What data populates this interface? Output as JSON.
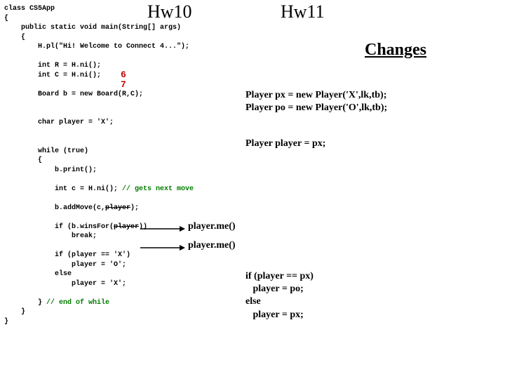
{
  "titles": {
    "left": "Hw10",
    "right": "Hw11",
    "changes": "Changes"
  },
  "code": {
    "l1": "class CS5App",
    "l2": "{",
    "l3": "    public static void main(String[] args)",
    "l4": "    {",
    "l5": "        H.pl(\"Hi! Welcome to Connect 4...\");",
    "l6": "        int R = H.ni();",
    "l7": "        int C = H.ni();",
    "rc6": "6",
    "rc7": "7",
    "l8": "        Board b = new Board(R,C);",
    "l9": "        char player = 'X';",
    "l10": "        while (true)",
    "l11": "        {",
    "l12": "            b.print();",
    "l13a": "            int c = H.ni(); ",
    "l13b": "// gets next move",
    "l14a": "            b.addMove(c,",
    "l14b": "player",
    "l14c": ");",
    "l15a": "            if (b.winsFor(",
    "l15b": "player",
    "l15c": "))",
    "l16": "                break;",
    "l17": "            if (player == 'X')",
    "l18": "                player = 'O';",
    "l19": "            else",
    "l20": "                player = 'X';",
    "l21a": "        } ",
    "l21b": "// end of while",
    "l22": "    }",
    "l23": "}"
  },
  "right": {
    "px": "Player px = new Player('X',lk,tb);",
    "po": "Player po = new Player('O',lk,tb);",
    "player": "Player player = px;",
    "me1": "player.me()",
    "me2": "player.me()",
    "swap_if": "if (player == px)",
    "swap_then": "   player = po;",
    "swap_else": "else",
    "swap_elsb": "   player = px;"
  }
}
